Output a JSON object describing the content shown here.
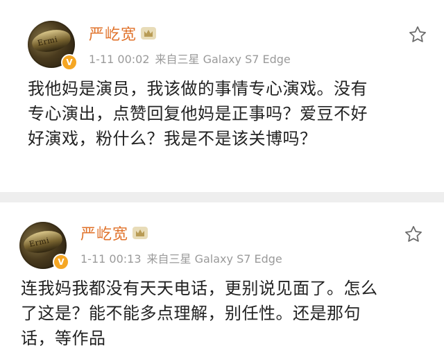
{
  "posts": [
    {
      "user_name": "严屹宽",
      "timestamp": "1-11 00:02",
      "source": "来自三星 Galaxy S7 Edge",
      "avatar_text": "Ermi",
      "verified_badge": "V",
      "text_lines": [
        "我他妈是演员，我该做的事情专心演戏。没有",
        "专心演出，点赞回复他妈是正事吗？爱豆不好",
        "好演戏，粉什么？我是不是该关博吗？"
      ]
    },
    {
      "user_name": "严屹宽",
      "timestamp": "1-11 00:13",
      "source": "来自三星 Galaxy S7 Edge",
      "avatar_text": "Ermi",
      "verified_badge": "V",
      "text_lines": [
        "连我妈我都没有天天电话，更别说见面了。怎么",
        "了这是？能不能多点理解，别任性。还是那句",
        "话，等作品"
      ]
    }
  ],
  "icons": {
    "favorite": "star-outline-icon",
    "verified": "verified-v-badge-icon",
    "member": "crown-badge-icon"
  },
  "colors": {
    "username": "#e0722a",
    "meta": "#9a9a9a",
    "verified": "#f5a623"
  }
}
